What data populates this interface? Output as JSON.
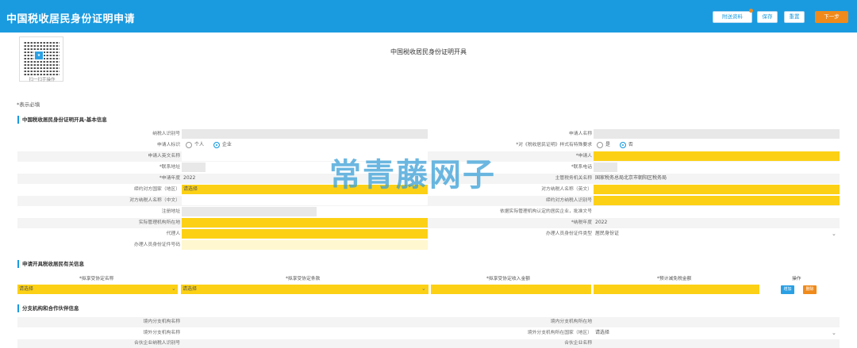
{
  "app": {
    "title": "中国税收居民身份证明申请"
  },
  "toolbar": {
    "attach_label": "附送资料",
    "save_label": "保存",
    "reset_label": "重置",
    "next_label": "下一步"
  },
  "qr": {
    "caption": "扫一扫手操作"
  },
  "page": {
    "title": "中国税收居民身份证明开具",
    "required_note": "*表示必填"
  },
  "sections": {
    "basic": "中国税收居民身份证明开具-基本信息",
    "income": "申请开具税收居民有关信息",
    "branch": "分支机构和合作伙伴信息"
  },
  "basic": {
    "taxpayer_id_label": "纳税人识别号",
    "applicant_name_label": "申请人名称",
    "applicant_flag_label": "申请人标识",
    "flag_options": [
      "个人",
      "企业"
    ],
    "flag_selected": "企业",
    "special_req_label": "*对《税收居民证明》样式有特殊要求",
    "yesno_options": [
      "是",
      "否"
    ],
    "yesno_selected": "否",
    "english_name_label": "申请人英文名称",
    "applicant_label": "*申请人",
    "contact_addr_label": "*联系地址",
    "contact_phone_label": "*联系电话",
    "apply_year_label": "*申请年度",
    "apply_year_value": "2022",
    "tax_authority_label": "主管税务机关名称",
    "tax_authority_value": "国家税务总局北京市朝阳区税务局",
    "counterpart_country_label": "缔约对方国家（地区）",
    "counterpart_country_value": "请选择",
    "counterpart_en_label": "对方纳税人名称（英文）",
    "counterpart_cn_label": "对方纳税人名称（中文）",
    "counterpart_id_label": "缔约对方纳税人识别号",
    "reg_addr_label": "注册地址",
    "legal_basis_label": "依据实际管理机构认定的居民企业，批准文号",
    "actual_mgmt_label": "实际管理机构所在地",
    "tax_year_label": "*纳税年度",
    "tax_year_value": "2022",
    "agent_label": "代理人",
    "agent_id_type_label": "办理人员身份证件类型",
    "agent_id_type_value": "居民身份证",
    "agent_id_no_label": "办理人员身份证件号码"
  },
  "income_table": {
    "headers": [
      "*拟享受协定名称",
      "*拟享受协定条款",
      "*拟享受协定收入金额",
      "*预计减免税金额",
      "操作"
    ],
    "row": {
      "agreement": "请选择",
      "clause": "请选择"
    },
    "add_label": "增加",
    "delete_label": "删除"
  },
  "branch": {
    "domestic_branch_label": "境内分支机构名称",
    "domestic_branch_loc_label": "境内分支机构所在地",
    "foreign_branch_label": "境外分支机构名称",
    "foreign_branch_country_label": "境外分支机构所在国家（地区）",
    "foreign_branch_country_value": "请选择",
    "partner_id_label": "合伙企业纳税人识别号",
    "partner_name_label": "合伙企业名称"
  },
  "watermark": "常青藤网子",
  "colors": {
    "header": "#1a9be0",
    "highlight": "#fcd115",
    "accent_orange": "#ef8a1b"
  }
}
